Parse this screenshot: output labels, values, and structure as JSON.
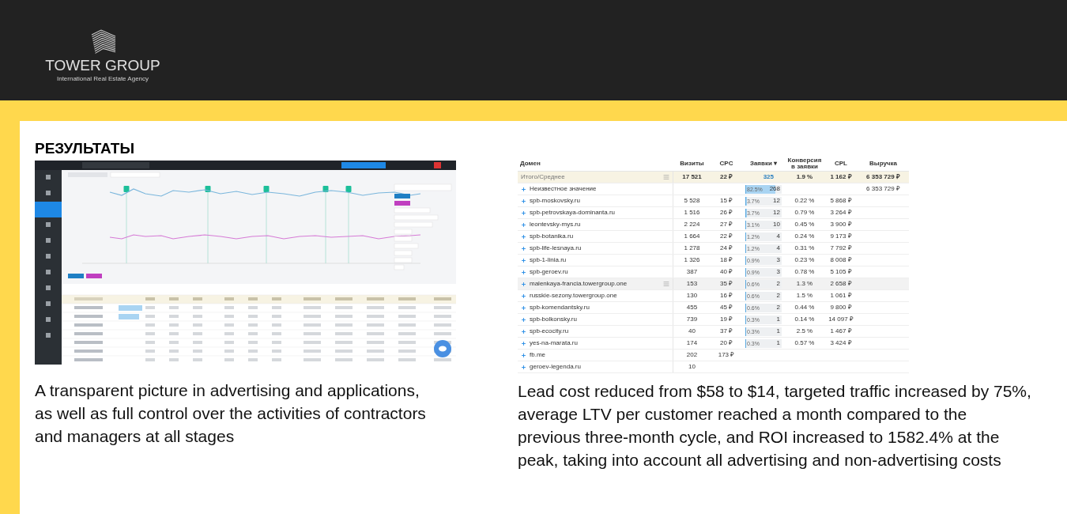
{
  "header": {
    "logo_title": "TOWER GROUP",
    "logo_subtitle": "International Real Estate Agency"
  },
  "section": {
    "heading": "РЕЗУЛЬТАТЫ"
  },
  "left": {
    "caption": "A transparent picture in advertising and applications, as well as full control over the activities of contractors and managers at all stages"
  },
  "right": {
    "table": {
      "columns": [
        "Домен",
        "Визиты",
        "CPC",
        "Заявки ▾",
        "Конверсия в заявки",
        "CPL",
        "Выручка"
      ],
      "rows": [
        {
          "kind": "total",
          "domain": "Итого/Среднее",
          "visits": "17 521",
          "cpc": "22 ₽",
          "leads": "325",
          "conversion": "1.9 %",
          "cpl": "1 162 ₽",
          "revenue": "6 353 729 ₽"
        },
        {
          "kind": "row",
          "domain": "Неизвестное значение",
          "visits": "",
          "cpc": "",
          "leads": "268",
          "share": "82.5%",
          "level": 0.825,
          "conversion": "",
          "cpl": "",
          "revenue": "6 353 729 ₽"
        },
        {
          "kind": "row",
          "domain": "spb-moskovsky.ru",
          "visits": "5 528",
          "cpc": "15 ₽",
          "leads": "12",
          "share": "3.7%",
          "level": 0.037,
          "conversion": "0.22 %",
          "cpl": "5 868 ₽",
          "revenue": ""
        },
        {
          "kind": "row",
          "domain": "spb-petrovskaya-dominanta.ru",
          "visits": "1 516",
          "cpc": "26 ₽",
          "leads": "12",
          "share": "3.7%",
          "level": 0.037,
          "conversion": "0.79 %",
          "cpl": "3 264 ₽",
          "revenue": ""
        },
        {
          "kind": "row",
          "domain": "leontevsky-mys.ru",
          "visits": "2 224",
          "cpc": "27 ₽",
          "leads": "10",
          "share": "3.1%",
          "level": 0.031,
          "conversion": "0.45 %",
          "cpl": "3 900 ₽",
          "revenue": ""
        },
        {
          "kind": "row",
          "domain": "spb-botanika.ru",
          "visits": "1 664",
          "cpc": "22 ₽",
          "leads": "4",
          "share": "1.2%",
          "level": 0.012,
          "conversion": "0.24 %",
          "cpl": "9 173 ₽",
          "revenue": ""
        },
        {
          "kind": "row",
          "domain": "spb-life-lesnaya.ru",
          "visits": "1 278",
          "cpc": "24 ₽",
          "leads": "4",
          "share": "1.2%",
          "level": 0.012,
          "conversion": "0.31 %",
          "cpl": "7 792 ₽",
          "revenue": ""
        },
        {
          "kind": "row",
          "domain": "spb-1-linia.ru",
          "visits": "1 326",
          "cpc": "18 ₽",
          "leads": "3",
          "share": "0.9%",
          "level": 0.009,
          "conversion": "0.23 %",
          "cpl": "8 008 ₽",
          "revenue": ""
        },
        {
          "kind": "row",
          "domain": "spb-geroev.ru",
          "visits": "387",
          "cpc": "40 ₽",
          "leads": "3",
          "share": "0.9%",
          "level": 0.009,
          "conversion": "0.78 %",
          "cpl": "5 105 ₽",
          "revenue": ""
        },
        {
          "kind": "hovered",
          "domain": "malenkaya-francia.towergroup.one",
          "visits": "153",
          "cpc": "35 ₽",
          "leads": "2",
          "share": "0.6%",
          "level": 0.006,
          "conversion": "1.3 %",
          "cpl": "2 658 ₽",
          "revenue": ""
        },
        {
          "kind": "row",
          "domain": "russkie-sezony.towergroup.one",
          "visits": "130",
          "cpc": "16 ₽",
          "leads": "2",
          "share": "0.6%",
          "level": 0.006,
          "conversion": "1.5 %",
          "cpl": "1 061 ₽",
          "revenue": ""
        },
        {
          "kind": "row",
          "domain": "spb-komendantsky.ru",
          "visits": "455",
          "cpc": "45 ₽",
          "leads": "2",
          "share": "0.6%",
          "level": 0.006,
          "conversion": "0.44 %",
          "cpl": "9 800 ₽",
          "revenue": ""
        },
        {
          "kind": "row",
          "domain": "spb-bolkonsky.ru",
          "visits": "739",
          "cpc": "19 ₽",
          "leads": "1",
          "share": "0.3%",
          "level": 0.003,
          "conversion": "0.14 %",
          "cpl": "14 097 ₽",
          "revenue": ""
        },
        {
          "kind": "row",
          "domain": "spb-ecocity.ru",
          "visits": "40",
          "cpc": "37 ₽",
          "leads": "1",
          "share": "0.3%",
          "level": 0.003,
          "conversion": "2.5 %",
          "cpl": "1 467 ₽",
          "revenue": ""
        },
        {
          "kind": "row",
          "domain": "yes-na-marata.ru",
          "visits": "174",
          "cpc": "20 ₽",
          "leads": "1",
          "share": "0.3%",
          "level": 0.003,
          "conversion": "0.57 %",
          "cpl": "3 424 ₽",
          "revenue": ""
        },
        {
          "kind": "row",
          "domain": "fb.me",
          "visits": "202",
          "cpc": "173 ₽",
          "leads": "",
          "conversion": "",
          "cpl": "",
          "revenue": ""
        },
        {
          "kind": "row",
          "domain": "geroev-legenda.ru",
          "visits": "10",
          "cpc": "",
          "leads": "",
          "conversion": "",
          "cpl": "",
          "revenue": ""
        }
      ]
    },
    "caption": "Lead cost reduced from $58 to $14, targeted traffic increased by 75%, average LTV per customer reached a month compared to the previous three-month cycle, and ROI increased to 1582.4% at the peak, taking into account all advertising and non-advertising costs"
  }
}
